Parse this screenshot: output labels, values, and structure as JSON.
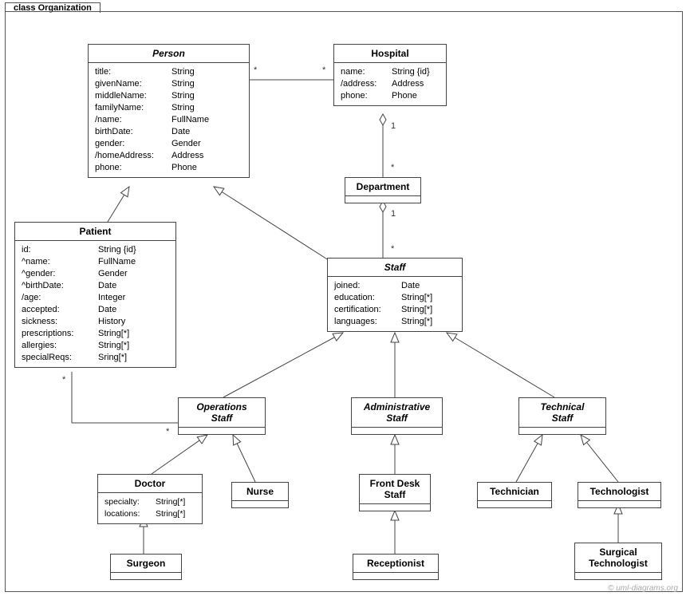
{
  "frame": {
    "title": "class Organization",
    "watermark": "© uml-diagrams.org"
  },
  "classes": {
    "person": {
      "name": "Person",
      "attrs": [
        {
          "n": "title:",
          "t": "String"
        },
        {
          "n": "givenName:",
          "t": "String"
        },
        {
          "n": "middleName:",
          "t": "String"
        },
        {
          "n": "familyName:",
          "t": "String"
        },
        {
          "n": "/name:",
          "t": "FullName"
        },
        {
          "n": "birthDate:",
          "t": "Date"
        },
        {
          "n": "gender:",
          "t": "Gender"
        },
        {
          "n": "/homeAddress:",
          "t": "Address"
        },
        {
          "n": "phone:",
          "t": "Phone"
        }
      ]
    },
    "hospital": {
      "name": "Hospital",
      "attrs": [
        {
          "n": "name:",
          "t": "String {id}"
        },
        {
          "n": "/address:",
          "t": "Address"
        },
        {
          "n": "phone:",
          "t": "Phone"
        }
      ]
    },
    "department": {
      "name": "Department"
    },
    "patient": {
      "name": "Patient",
      "attrs": [
        {
          "n": "id:",
          "t": "String {id}"
        },
        {
          "n": "^name:",
          "t": "FullName"
        },
        {
          "n": "^gender:",
          "t": "Gender"
        },
        {
          "n": "^birthDate:",
          "t": "Date"
        },
        {
          "n": "/age:",
          "t": "Integer"
        },
        {
          "n": "accepted:",
          "t": "Date"
        },
        {
          "n": "sickness:",
          "t": "History"
        },
        {
          "n": "prescriptions:",
          "t": "String[*]"
        },
        {
          "n": "allergies:",
          "t": "String[*]"
        },
        {
          "n": "specialReqs:",
          "t": "Sring[*]"
        }
      ]
    },
    "staff": {
      "name": "Staff",
      "attrs": [
        {
          "n": "joined:",
          "t": "Date"
        },
        {
          "n": "education:",
          "t": "String[*]"
        },
        {
          "n": "certification:",
          "t": "String[*]"
        },
        {
          "n": "languages:",
          "t": "String[*]"
        }
      ]
    },
    "opsStaff": {
      "name": "Operations",
      "name2": "Staff"
    },
    "adminStaff": {
      "name": "Administrative",
      "name2": "Staff"
    },
    "techStaff": {
      "name": "Technical",
      "name2": "Staff"
    },
    "doctor": {
      "name": "Doctor",
      "attrs": [
        {
          "n": "specialty:",
          "t": "String[*]"
        },
        {
          "n": "locations:",
          "t": "String[*]"
        }
      ]
    },
    "nurse": {
      "name": "Nurse"
    },
    "frontDesk": {
      "name": "Front Desk",
      "name2": "Staff"
    },
    "technician": {
      "name": "Technician"
    },
    "technologist": {
      "name": "Technologist"
    },
    "surgeon": {
      "name": "Surgeon"
    },
    "receptionist": {
      "name": "Receptionist"
    },
    "surgTech": {
      "name": "Surgical",
      "name2": "Technologist"
    }
  },
  "mults": {
    "personHospitalL": "*",
    "personHospitalR": "*",
    "hospDept1": "1",
    "hospDeptStar": "*",
    "deptStaff1": "1",
    "deptStaffStar": "*",
    "patientOpsL": "*",
    "patientOpsR": "*"
  }
}
